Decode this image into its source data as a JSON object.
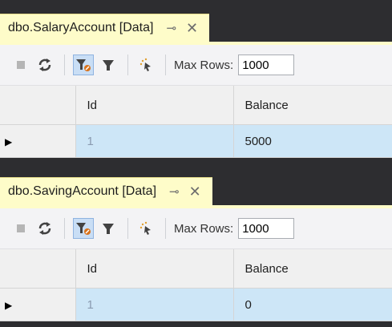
{
  "panels": [
    {
      "tab": {
        "title": "dbo.SalaryAccount [Data]",
        "pin_icon": "pin-icon",
        "close_icon": "close-icon"
      },
      "toolbar": {
        "buttons": [
          "stop-icon",
          "refresh-icon",
          "filter-active-icon",
          "filter-icon",
          "script-icon"
        ],
        "max_rows_label": "Max Rows:",
        "max_rows_value": "1000"
      },
      "grid": {
        "columns": [
          "Id",
          "Balance"
        ],
        "rows": [
          {
            "indicator": "▶",
            "id": "1",
            "balance": "5000"
          }
        ]
      }
    },
    {
      "tab": {
        "title": "dbo.SavingAccount [Data]",
        "pin_icon": "pin-icon",
        "close_icon": "close-icon"
      },
      "toolbar": {
        "buttons": [
          "stop-icon",
          "refresh-icon",
          "filter-active-icon",
          "filter-icon",
          "script-icon"
        ],
        "max_rows_label": "Max Rows:",
        "max_rows_value": "1000"
      },
      "grid": {
        "columns": [
          "Id",
          "Balance"
        ],
        "rows": [
          {
            "indicator": "▶",
            "id": "1",
            "balance": "0"
          }
        ]
      }
    }
  ],
  "colors": {
    "tab_background": "#fefcc9",
    "selected_row": "#cde6f7",
    "dark_background": "#2d2d30"
  }
}
